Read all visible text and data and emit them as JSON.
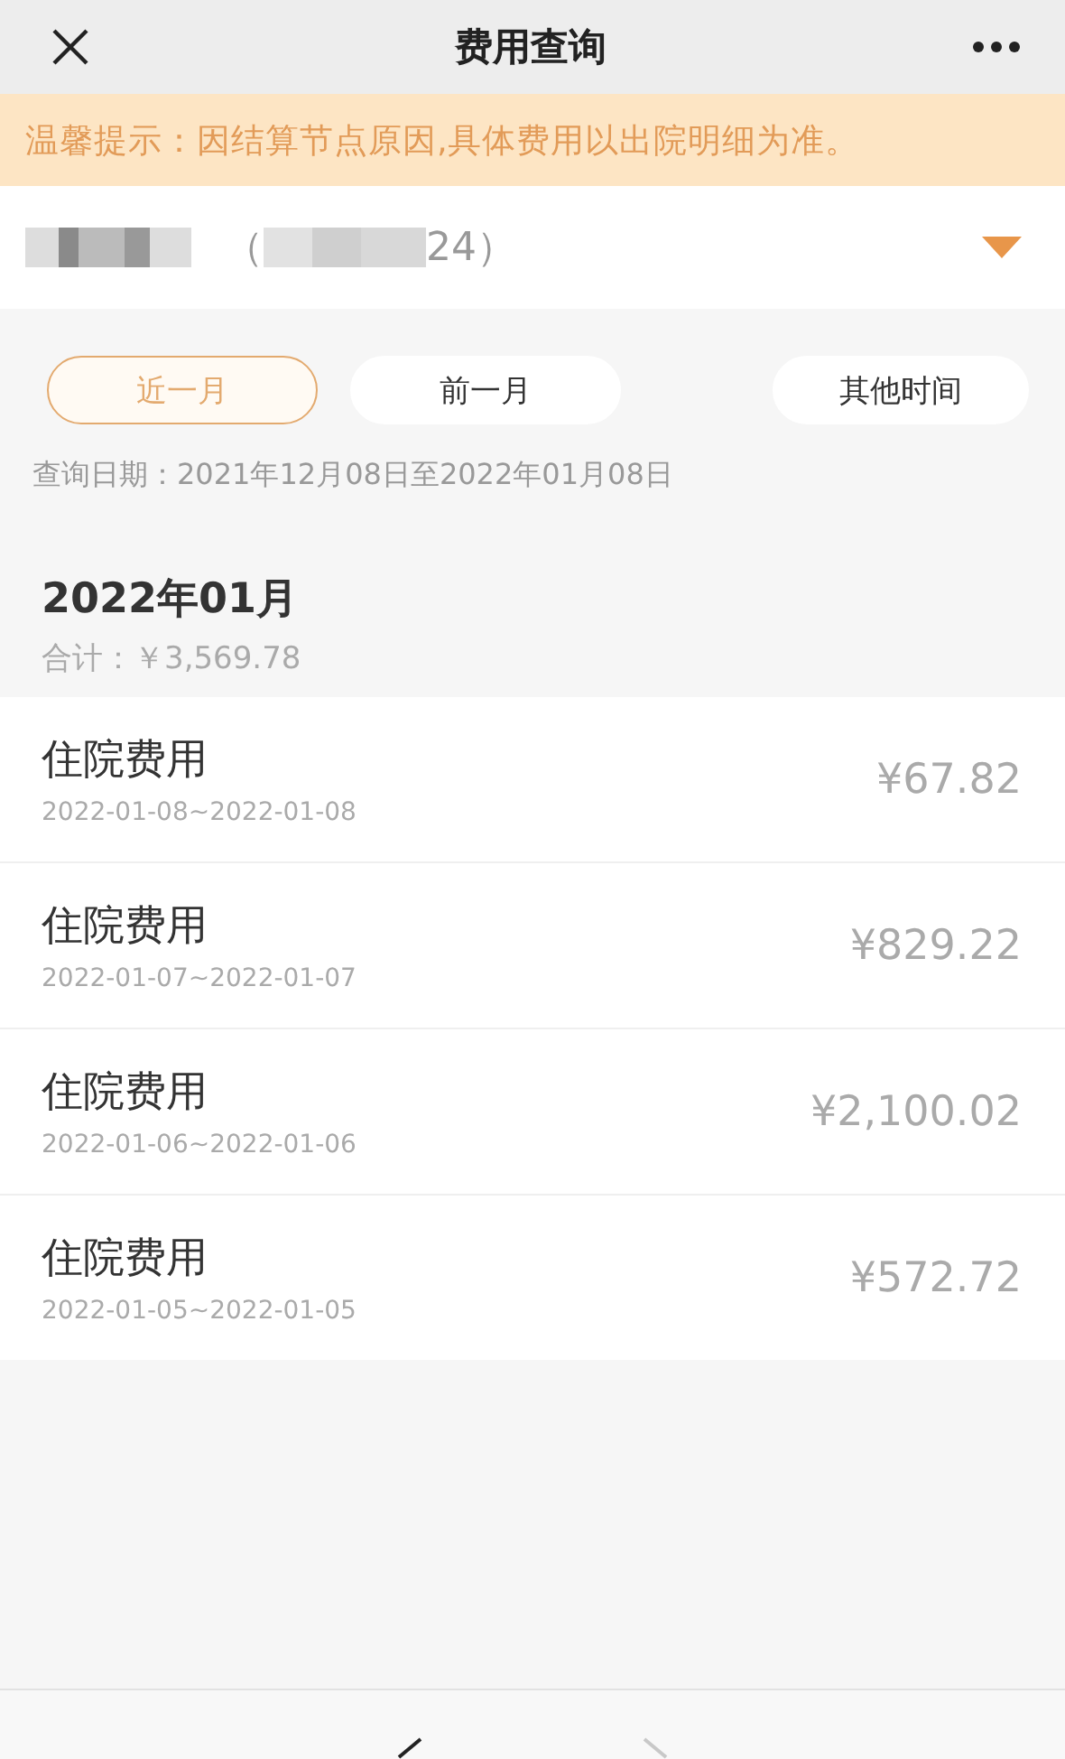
{
  "nav_bar": {
    "title": "费用查询"
  },
  "notice": "温馨提示：因结算节点原因,具体费用以出院明细为准。",
  "patient": {
    "open_paren": "（",
    "id_tail": "24）",
    "obscured": true
  },
  "tabs": [
    {
      "label": "近一月",
      "selected": true
    },
    {
      "label": "前一月",
      "selected": false
    },
    {
      "label": "其他时间",
      "selected": false
    }
  ],
  "query_range": "查询日期：2021年12月08日至2022年01月08日",
  "month": {
    "title": "2022年01月",
    "total": "合计：￥3,569.78"
  },
  "records": [
    {
      "name": "住院费用",
      "dates": "2022-01-08~2022-01-08",
      "amount": "¥67.82"
    },
    {
      "name": "住院费用",
      "dates": "2022-01-07~2022-01-07",
      "amount": "¥829.22"
    },
    {
      "name": "住院费用",
      "dates": "2022-01-06~2022-01-06",
      "amount": "¥2,100.02"
    },
    {
      "name": "住院费用",
      "dates": "2022-01-05~2022-01-05",
      "amount": "¥572.72"
    }
  ],
  "toolbar": {
    "back_disabled": false,
    "forward_disabled": true
  }
}
